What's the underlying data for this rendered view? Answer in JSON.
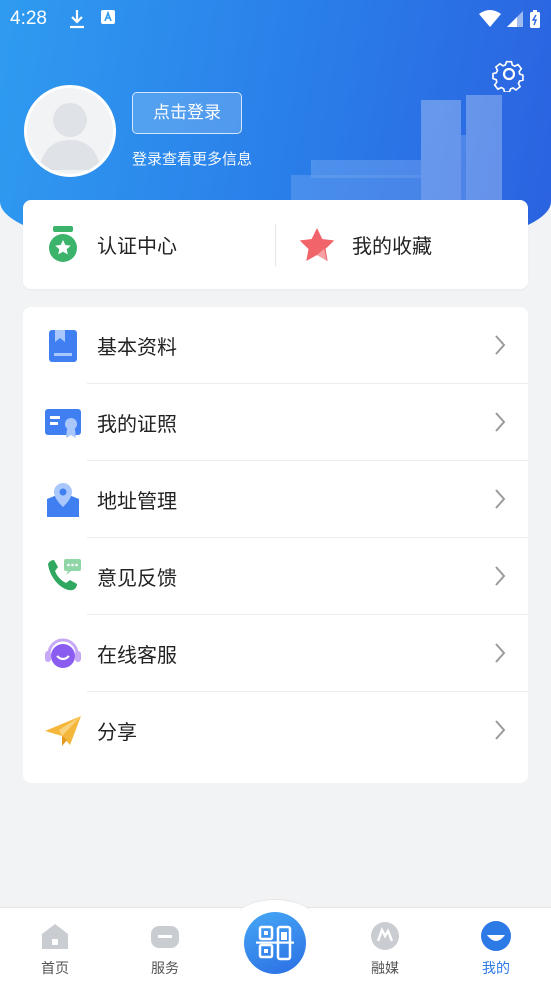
{
  "status": {
    "time": "4:28"
  },
  "profile": {
    "login_button": "点击登录",
    "login_hint": "登录查看更多信息"
  },
  "quick": [
    {
      "label": "认证中心",
      "icon": "certification-badge-icon",
      "color": "#3bb36a"
    },
    {
      "label": "我的收藏",
      "icon": "star-icon",
      "color": "#f0646a"
    }
  ],
  "menu": [
    {
      "label": "基本资料",
      "icon": "profile-book-icon"
    },
    {
      "label": "我的证照",
      "icon": "license-card-icon"
    },
    {
      "label": "地址管理",
      "icon": "location-pin-icon"
    },
    {
      "label": "意见反馈",
      "icon": "phone-feedback-icon"
    },
    {
      "label": "在线客服",
      "icon": "headset-service-icon"
    },
    {
      "label": "分享",
      "icon": "paper-plane-icon"
    }
  ],
  "tabs": [
    {
      "label": "首页",
      "icon": "home-icon"
    },
    {
      "label": "服务",
      "icon": "service-icon"
    },
    {
      "label": "融媒",
      "icon": "media-icon"
    },
    {
      "label": "我的",
      "icon": "me-icon",
      "active": true
    }
  ],
  "colors": {
    "brand": "#2d7ae6",
    "background": "#f1f3f5"
  }
}
